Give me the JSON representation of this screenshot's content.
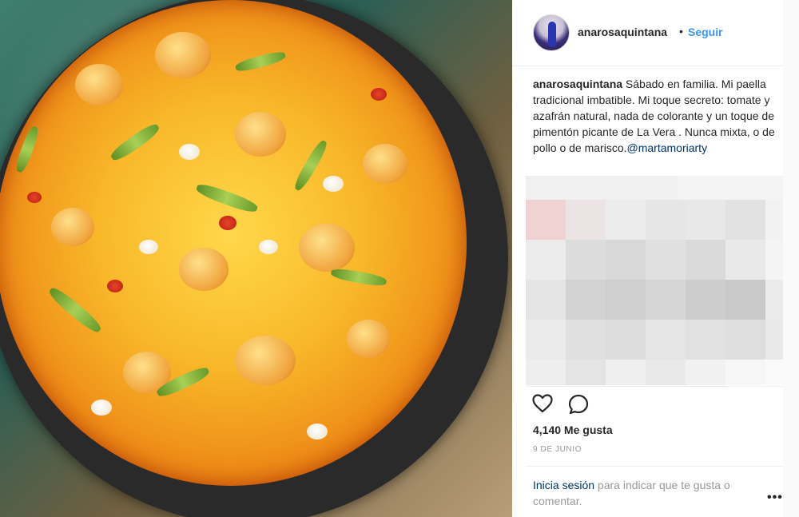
{
  "post": {
    "image_alt": "paella photo"
  },
  "header": {
    "username": "anarosaquintana",
    "separator": "•",
    "follow_label": "Seguir"
  },
  "caption": {
    "username": "anarosaquintana",
    "text": " Sábado en familia. Mi paella tradicional imbatible. Mi toque secreto: tomate y azafrán natural, nada de colorante y un toque de pimentón picante de La Vera . Nunca mixta, o de pollo o de marisco.",
    "mention": "@martamoriarty"
  },
  "actions": {
    "like_icon": "heart-icon",
    "comment_icon": "comment-bubble-icon",
    "likes_text": "4,140 Me gusta",
    "date": "9 DE JUNIO"
  },
  "login": {
    "link_label": "Inicia sesión",
    "rest_text": " para indicar que te gusta o comentar."
  },
  "more": {
    "label": "•••"
  }
}
